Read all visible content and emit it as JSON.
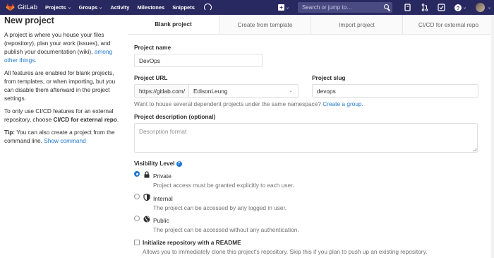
{
  "nav": {
    "brand": "GitLab",
    "projects": "Projects",
    "groups": "Groups",
    "activity": "Activity",
    "milestones": "Milestones",
    "snippets": "Snippets",
    "search_placeholder": "Search or jump to…"
  },
  "left": {
    "title": "New project",
    "p1_text": "A project is where you house your files (repository), plan your work (issues), and publish your documentation (wiki), ",
    "p1_link": "among other things",
    "p1_end": ".",
    "p2": "All features are enabled for blank projects, from templates, or when importing, but you can disable them afterward in the project settings.",
    "p3_text": "To only use CI/CD features for an external repository, choose ",
    "p3_bold": "CI/CD for external repo",
    "p3_end": ".",
    "tip_label": "Tip:",
    "tip_text": " You can also create a project from the command line. ",
    "tip_link": "Show command"
  },
  "tabs": [
    {
      "label": "Blank project"
    },
    {
      "label": "Create from template"
    },
    {
      "label": "Import project"
    },
    {
      "label": "CI/CD for external repo"
    }
  ],
  "form": {
    "name_label": "Project name",
    "name_value": "DevOps",
    "url_label": "Project URL",
    "url_prefix": "https://gitlab.com/",
    "namespace_value": "EdisonLeung",
    "slug_label": "Project slug",
    "slug_value": "devops",
    "namespace_help": "Want to house several dependent projects under the same namespace? ",
    "namespace_link": "Create a group.",
    "desc_label": "Project description (optional)",
    "desc_placeholder": "Description format",
    "visibility_label": "Visibility Level",
    "visibility": [
      {
        "title": "Private",
        "desc": "Project access must be granted explicitly to each user.",
        "checked": true
      },
      {
        "title": "Internal",
        "desc": "The project can be accessed by any logged in user.",
        "checked": false
      },
      {
        "title": "Public",
        "desc": "The project can be accessed without any authentication.",
        "checked": false
      }
    ],
    "readme_label": "Initialize repository with a README",
    "readme_desc": "Allows you to immediately clone this project's repository. Skip this if you plan to push up an existing repository."
  }
}
